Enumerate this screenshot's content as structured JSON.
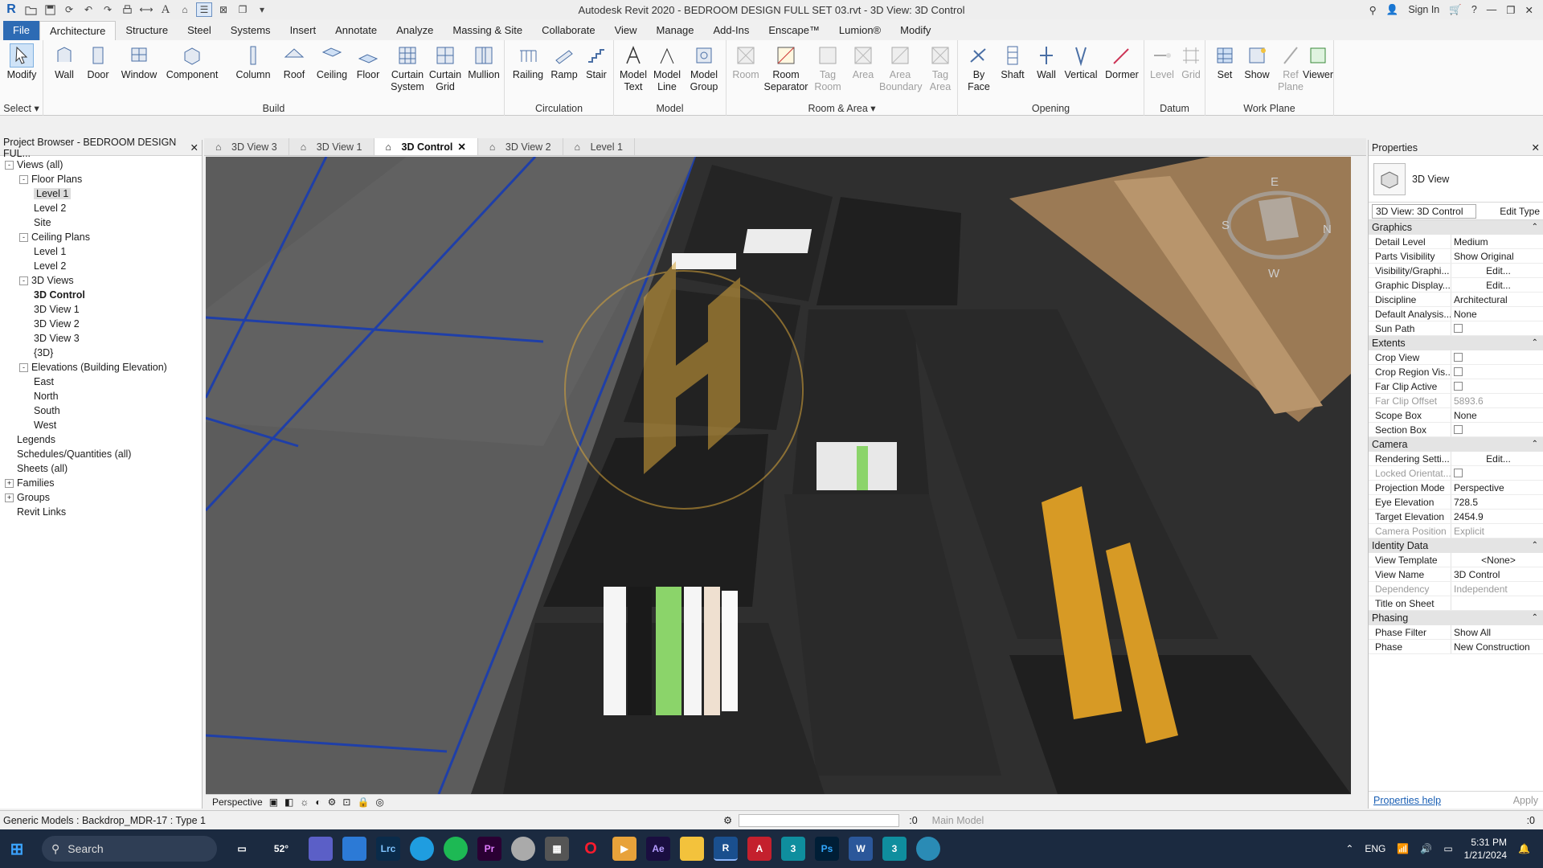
{
  "titlebar": {
    "title": "Autodesk Revit 2020 - BEDROOM DESIGN FULL SET 03.rvt - 3D View: 3D Control",
    "sign_in": "Sign In",
    "icons": [
      "revit-logo",
      "open",
      "save",
      "sync",
      "undo",
      "redo",
      "print",
      "measure",
      "text",
      "switch-windows",
      "thin-lines",
      "close-hidden"
    ]
  },
  "ribbon_tabs": [
    "File",
    "Architecture",
    "Structure",
    "Steel",
    "Systems",
    "Insert",
    "Annotate",
    "Analyze",
    "Massing & Site",
    "Collaborate",
    "View",
    "Manage",
    "Add-Ins",
    "Enscape™",
    "Lumion®",
    "Modify"
  ],
  "active_tab": "Architecture",
  "ribbon": {
    "select_label": "Select",
    "panels": {
      "build": "Build",
      "circulation": "Circulation",
      "model": "Model",
      "room_area": "Room & Area",
      "opening": "Opening",
      "datum": "Datum",
      "work_plane": "Work Plane"
    },
    "tools": {
      "modify": "Modify",
      "wall": "Wall",
      "door": "Door",
      "window": "Window",
      "component": "Component",
      "column": "Column",
      "roof": "Roof",
      "ceiling": "Ceiling",
      "floor": "Floor",
      "curtain_system": "Curtain System",
      "curtain_grid": "Curtain Grid",
      "mullion": "Mullion",
      "railing": "Railing",
      "ramp": "Ramp",
      "stair": "Stair",
      "model_text": "Model Text",
      "model_line": "Model Line",
      "model_group": "Model Group",
      "room": "Room",
      "room_separator": "Room Separator",
      "tag_room": "Tag Room",
      "area": "Area",
      "area_boundary": "Area Boundary",
      "tag_area": "Tag Area",
      "by_face": "By Face",
      "shaft": "Shaft",
      "wall_open": "Wall",
      "vertical": "Vertical",
      "dormer": "Dormer",
      "level": "Level",
      "grid": "Grid",
      "set": "Set",
      "show": "Show",
      "ref_plane": "Ref Plane",
      "viewer": "Viewer"
    }
  },
  "project_browser": {
    "title": "Project Browser - BEDROOM DESIGN FUL...",
    "tree": [
      {
        "label": "Views (all)",
        "level": 0,
        "tog": "-"
      },
      {
        "label": "Floor Plans",
        "level": 1,
        "tog": "-"
      },
      {
        "label": "Level 1",
        "level": 2,
        "sel": true
      },
      {
        "label": "Level 2",
        "level": 2
      },
      {
        "label": "Site",
        "level": 2
      },
      {
        "label": "Ceiling Plans",
        "level": 1,
        "tog": "-"
      },
      {
        "label": "Level 1",
        "level": 2
      },
      {
        "label": "Level 2",
        "level": 2
      },
      {
        "label": "3D Views",
        "level": 1,
        "tog": "-"
      },
      {
        "label": "3D Control",
        "level": 2,
        "bold": true
      },
      {
        "label": "3D View 1",
        "level": 2
      },
      {
        "label": "3D View 2",
        "level": 2
      },
      {
        "label": "3D View 3",
        "level": 2
      },
      {
        "label": "{3D}",
        "level": 2
      },
      {
        "label": "Elevations (Building Elevation)",
        "level": 1,
        "tog": "-"
      },
      {
        "label": "East",
        "level": 2
      },
      {
        "label": "North",
        "level": 2
      },
      {
        "label": "South",
        "level": 2
      },
      {
        "label": "West",
        "level": 2
      },
      {
        "label": "Legends",
        "level": 0
      },
      {
        "label": "Schedules/Quantities (all)",
        "level": 0
      },
      {
        "label": "Sheets (all)",
        "level": 0
      },
      {
        "label": "Families",
        "level": 0,
        "tog": "+"
      },
      {
        "label": "Groups",
        "level": 0,
        "tog": "+"
      },
      {
        "label": "Revit Links",
        "level": 0
      }
    ]
  },
  "view_tabs": [
    {
      "label": "3D View 3"
    },
    {
      "label": "3D View 1"
    },
    {
      "label": "3D Control",
      "active": true
    },
    {
      "label": "3D View 2"
    },
    {
      "label": "Level 1"
    }
  ],
  "viewcube": {
    "n": "N",
    "s": "S",
    "e": "E",
    "w": "W"
  },
  "view_control": {
    "projection": "Perspective"
  },
  "properties": {
    "title": "Properties",
    "type_name": "3D View",
    "instance": "3D View: 3D Control",
    "edit_type": "Edit Type",
    "groups": [
      {
        "name": "Graphics",
        "rows": [
          [
            "Detail Level",
            "Medium"
          ],
          [
            "Parts Visibility",
            "Show Original"
          ],
          [
            "Visibility/Graphi...",
            "Edit..."
          ],
          [
            "Graphic Display...",
            "Edit..."
          ],
          [
            "Discipline",
            "Architectural"
          ],
          [
            "Default Analysis...",
            "None"
          ],
          [
            "Sun Path",
            "[cb]"
          ]
        ]
      },
      {
        "name": "Extents",
        "rows": [
          [
            "Crop View",
            "[cb]"
          ],
          [
            "Crop Region Vis...",
            "[cb]"
          ],
          [
            "Far Clip Active",
            "[cb]"
          ],
          [
            "Far Clip Offset",
            "5893.6"
          ],
          [
            "Scope Box",
            "None"
          ],
          [
            "Section Box",
            "[cb]"
          ]
        ]
      },
      {
        "name": "Camera",
        "rows": [
          [
            "Rendering Setti...",
            "Edit..."
          ],
          [
            "Locked Orientat...",
            "[cb]"
          ],
          [
            "Projection Mode",
            "Perspective"
          ],
          [
            "Eye Elevation",
            "728.5"
          ],
          [
            "Target Elevation",
            "2454.9"
          ],
          [
            "Camera Position",
            "Explicit"
          ]
        ]
      },
      {
        "name": "Identity Data",
        "rows": [
          [
            "View Template",
            "<None>"
          ],
          [
            "View Name",
            "3D Control"
          ],
          [
            "Dependency",
            "Independent"
          ],
          [
            "Title on Sheet",
            ""
          ]
        ]
      },
      {
        "name": "Phasing",
        "rows": [
          [
            "Phase Filter",
            "Show All"
          ],
          [
            "Phase",
            "New Construction"
          ]
        ]
      }
    ],
    "help_link": "Properties help",
    "apply": "Apply"
  },
  "status": {
    "text": "Generic Models : Backdrop_MDR-17 : Type 1",
    "counter": ":0",
    "model": "Main Model",
    "filter": ":0"
  },
  "taskbar": {
    "search": "Search",
    "weather": "52°",
    "lang": "ENG",
    "time": "5:31 PM",
    "date": "1/21/2024"
  }
}
